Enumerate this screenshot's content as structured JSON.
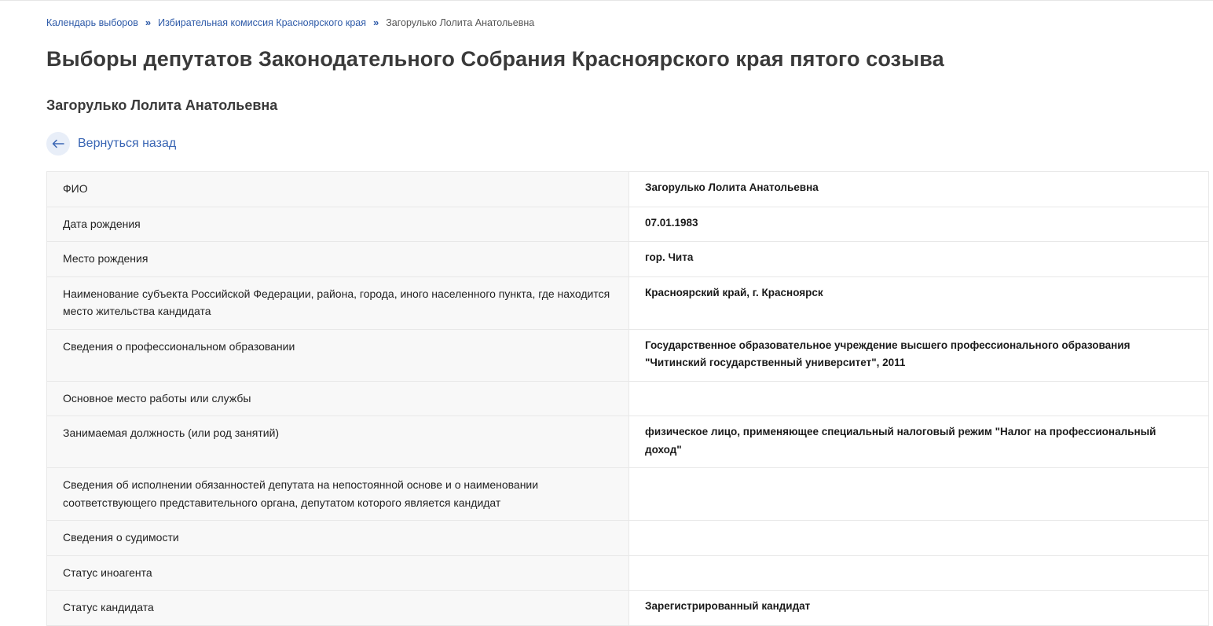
{
  "breadcrumb": {
    "items": [
      {
        "label": "Календарь выборов"
      },
      {
        "label": "Избирательная комиссия Красноярского края"
      }
    ],
    "separator": "»",
    "current": "Загорулько Лолита Анатольевна"
  },
  "page_title": "Выборы депутатов Законодательного Собрания Красноярского края пятого созыва",
  "candidate_name": "Загорулько Лолита Анатольевна",
  "back_link": {
    "label": "Вернуться назад",
    "icon": "arrow-left-icon"
  },
  "colors": {
    "link": "#2e5aa8",
    "title": "#3a3a3a",
    "label_bg": "#f8f8f8",
    "border": "#e8e8e8",
    "back_circle_bg": "#e8eef8"
  },
  "rows": [
    {
      "label": "ФИО",
      "value": "Загорулько Лолита Анатольевна"
    },
    {
      "label": "Дата рождения",
      "value": "07.01.1983"
    },
    {
      "label": "Место рождения",
      "value": "гор. Чита"
    },
    {
      "label": "Наименование субъекта Российской Федерации, района, города, иного населенного пункта, где находится место жительства кандидата",
      "value": "Красноярский край, г. Красноярск"
    },
    {
      "label": "Сведения о профессиональном образовании",
      "value": "Государственное образовательное учреждение высшего профессионального образования \"Читинский государственный университет\", 2011"
    },
    {
      "label": "Основное место работы или службы",
      "value": ""
    },
    {
      "label": "Занимаемая должность (или род занятий)",
      "value": "физическое лицо, применяющее специальный налоговый режим \"Налог на профессиональный доход\""
    },
    {
      "label": "Сведения об исполнении обязанностей депутата на непостоянной основе и о наименовании соответствующего представительного органа, депутатом которого является кандидат",
      "value": ""
    },
    {
      "label": "Сведения о судимости",
      "value": ""
    },
    {
      "label": "Статус иноагента",
      "value": ""
    },
    {
      "label": "Статус кандидата",
      "value": "Зарегистрированный кандидат"
    }
  ]
}
